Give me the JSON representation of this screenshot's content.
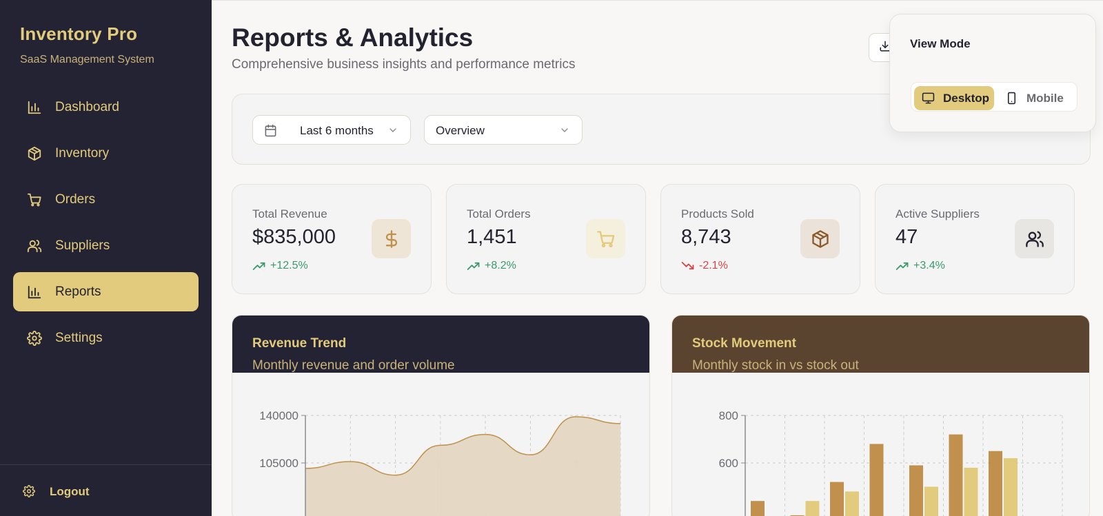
{
  "sidebar": {
    "brand_title": "Inventory Pro",
    "brand_subtitle": "SaaS Management System",
    "items": [
      {
        "label": "Dashboard",
        "icon": "bar-chart-icon",
        "active": false
      },
      {
        "label": "Inventory",
        "icon": "package-icon",
        "active": false
      },
      {
        "label": "Orders",
        "icon": "cart-icon",
        "active": false
      },
      {
        "label": "Suppliers",
        "icon": "users-icon",
        "active": false
      },
      {
        "label": "Reports",
        "icon": "bar-chart-icon",
        "active": true
      },
      {
        "label": "Settings",
        "icon": "gear-icon",
        "active": false
      }
    ],
    "logout_label": "Logout"
  },
  "header": {
    "title": "Reports & Analytics",
    "subtitle": "Comprehensive business insights and performance metrics"
  },
  "filters": {
    "date_range": "Last 6 months",
    "report_type": "Overview"
  },
  "stats": [
    {
      "label": "Total Revenue",
      "value": "$835,000",
      "change": "+12.5%",
      "trend": "up",
      "icon": "dollar-icon"
    },
    {
      "label": "Total Orders",
      "value": "1,451",
      "change": "+8.2%",
      "trend": "up",
      "icon": "cart-icon"
    },
    {
      "label": "Products Sold",
      "value": "8,743",
      "change": "-2.1%",
      "trend": "down",
      "icon": "package-icon"
    },
    {
      "label": "Active Suppliers",
      "value": "47",
      "change": "+3.4%",
      "trend": "up",
      "icon": "users-icon"
    }
  ],
  "view_mode": {
    "title": "View Mode",
    "desktop_label": "Desktop",
    "mobile_label": "Mobile",
    "selected": "Desktop"
  },
  "colors": {
    "sidebar_bg": "#232333",
    "accent": "#e2cb7d",
    "brown": "#5a4430",
    "bar_dark": "#c0904c",
    "positive": "#3a9a6a",
    "negative": "#d64545"
  },
  "charts": {
    "revenue": {
      "title": "Revenue Trend",
      "subtitle": "Monthly revenue and order volume"
    },
    "stock": {
      "title": "Stock Movement",
      "subtitle": "Monthly stock in vs stock out"
    }
  },
  "chart_data": [
    {
      "type": "area",
      "title": "Revenue Trend",
      "y_ticks": [
        105000,
        140000
      ],
      "ylim": [
        70000,
        140000
      ],
      "x_count": 7,
      "values": [
        101000,
        106000,
        96000,
        118000,
        126000,
        111000,
        139000,
        134000
      ],
      "grid": true
    },
    {
      "type": "bar",
      "title": "Stock Movement",
      "y_ticks": [
        600,
        800
      ],
      "ylim": [
        400,
        800
      ],
      "series": [
        {
          "values": [
            440,
            380,
            520,
            680,
            590,
            720,
            650
          ]
        },
        {
          "values": [
            null,
            440,
            480,
            null,
            500,
            580,
            620
          ]
        }
      ],
      "grid": true
    }
  ]
}
